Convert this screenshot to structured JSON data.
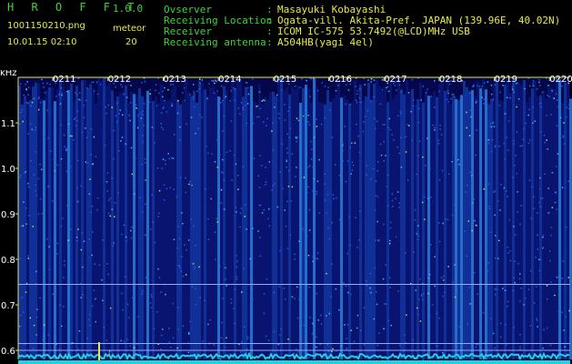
{
  "header": {
    "app_title": "H R O F F T",
    "version": "1.0.0",
    "file_name": "1001150210.png",
    "datetime": "10.01.15 02:10",
    "meteor_label": "meteor",
    "meteor_count": "20"
  },
  "info": {
    "rows": [
      {
        "key": "Ovserver",
        "value": "Masayuki Kobayashi"
      },
      {
        "key": "Receiving Location",
        "value": "Ogata-vill. Akita-Pref. JAPAN (139.96E, 40.02N)"
      },
      {
        "key": "Receiver",
        "value": "ICOM IC-575 53.7492(@LCD)MHz USB"
      },
      {
        "key": "Receiving antenna",
        "value": "A504HB(yagi 4el)"
      }
    ],
    "separator": ":"
  },
  "spectrogram": {
    "y_unit": "kHz",
    "y_ticks": [
      "1.1",
      "1.0",
      "0.9",
      "0.8",
      "0.7",
      "0.6"
    ],
    "y_range": [
      0.58,
      1.2
    ],
    "time_ticks": [
      "0211",
      "0212",
      "0213",
      "0214",
      "0215",
      "0216",
      "0217",
      "0218",
      "0219",
      "0220"
    ],
    "hlines_khz": [
      0.745,
      0.615,
      0.6
    ],
    "colors": {
      "axis": "#e8e84a",
      "tick_label": "#ffffff",
      "hline": "#9aa8ff",
      "baseline": "#22d0e0"
    }
  }
}
